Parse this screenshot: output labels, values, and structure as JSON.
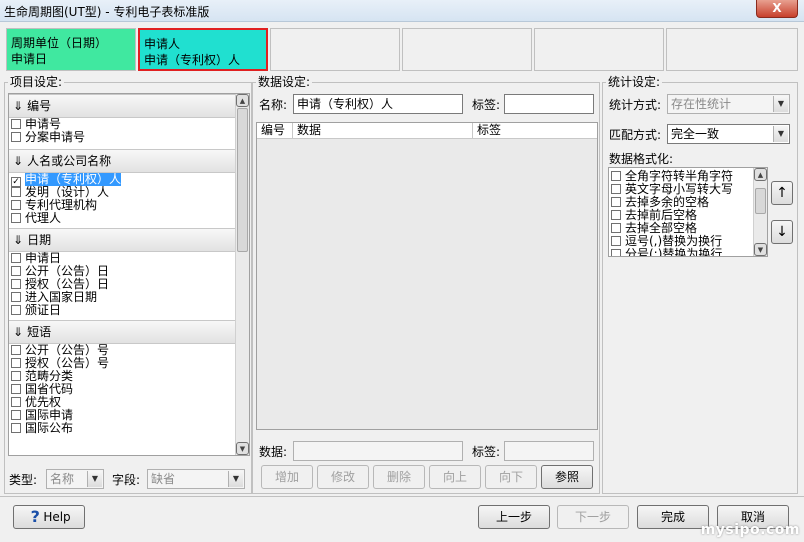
{
  "window": {
    "title": "生命周期图(UT型) - 专利电子表标准版",
    "close_label": "X"
  },
  "steps": [
    {
      "line1": "周期单位（日期）",
      "line2": "申请日"
    },
    {
      "line1": "申请人",
      "line2": "申请（专利权）人"
    },
    {
      "line1": "",
      "line2": ""
    },
    {
      "line1": "",
      "line2": ""
    },
    {
      "line1": "",
      "line2": ""
    },
    {
      "line1": "",
      "line2": ""
    }
  ],
  "project": {
    "title": "项目设定:",
    "sections": [
      {
        "header": "编号",
        "items": [
          {
            "label": "申请号",
            "checked": false
          },
          {
            "label": "分案申请号",
            "checked": false
          }
        ]
      },
      {
        "header": "人名或公司名称",
        "items": [
          {
            "label": "申请（专利权）人",
            "checked": true,
            "selected": true
          },
          {
            "label": "发明（设计）人",
            "checked": false
          },
          {
            "label": "专利代理机构",
            "checked": false
          },
          {
            "label": "代理人",
            "checked": false
          }
        ]
      },
      {
        "header": "日期",
        "items": [
          {
            "label": "申请日",
            "checked": false
          },
          {
            "label": "公开（公告）日",
            "checked": false
          },
          {
            "label": "授权（公告）日",
            "checked": false
          },
          {
            "label": "进入国家日期",
            "checked": false
          },
          {
            "label": "颁证日",
            "checked": false
          }
        ]
      },
      {
        "header": "短语",
        "items": [
          {
            "label": "公开（公告）号",
            "checked": false
          },
          {
            "label": "授权（公告）号",
            "checked": false
          },
          {
            "label": "范畴分类",
            "checked": false
          },
          {
            "label": "国省代码",
            "checked": false
          },
          {
            "label": "优先权",
            "checked": false
          },
          {
            "label": "国际申请",
            "checked": false
          },
          {
            "label": "国际公布",
            "checked": false
          }
        ]
      }
    ],
    "type_label": "类型:",
    "type_value": "名称",
    "field_label": "字段:",
    "field_value": "缺省"
  },
  "data_settings": {
    "title": "数据设定:",
    "name_label": "名称:",
    "name_value": "申请（专利权）人",
    "tag_label": "标签:",
    "tag_value": "",
    "columns": [
      "编号",
      "数据",
      "标签"
    ],
    "data_label": "数据:",
    "data_value": "",
    "tag2_label": "标签:",
    "tag2_value": "",
    "buttons": {
      "add": "增加",
      "modify": "修改",
      "delete": "删除",
      "up": "向上",
      "down": "向下",
      "ref": "参照"
    }
  },
  "stats": {
    "title": "统计设定:",
    "method_label": "统计方式:",
    "method_value": "存在性统计",
    "match_label": "匹配方式:",
    "match_value": "完全一致",
    "format_label": "数据格式化:",
    "format_items": [
      "全角字符转半角字符",
      "英文字母小写转大写",
      "去掉多余的空格",
      "去掉前后空格",
      "去掉全部空格",
      "逗号(,)替换为换行",
      "分号(;)替换为换行"
    ],
    "up_arrow": "↑",
    "down_arrow": "↓"
  },
  "footer": {
    "help": "Help",
    "help_icon": "?",
    "prev": "上一步",
    "next": "下一步",
    "finish": "完成",
    "cancel": "取消"
  },
  "watermark": "mysipo.com"
}
